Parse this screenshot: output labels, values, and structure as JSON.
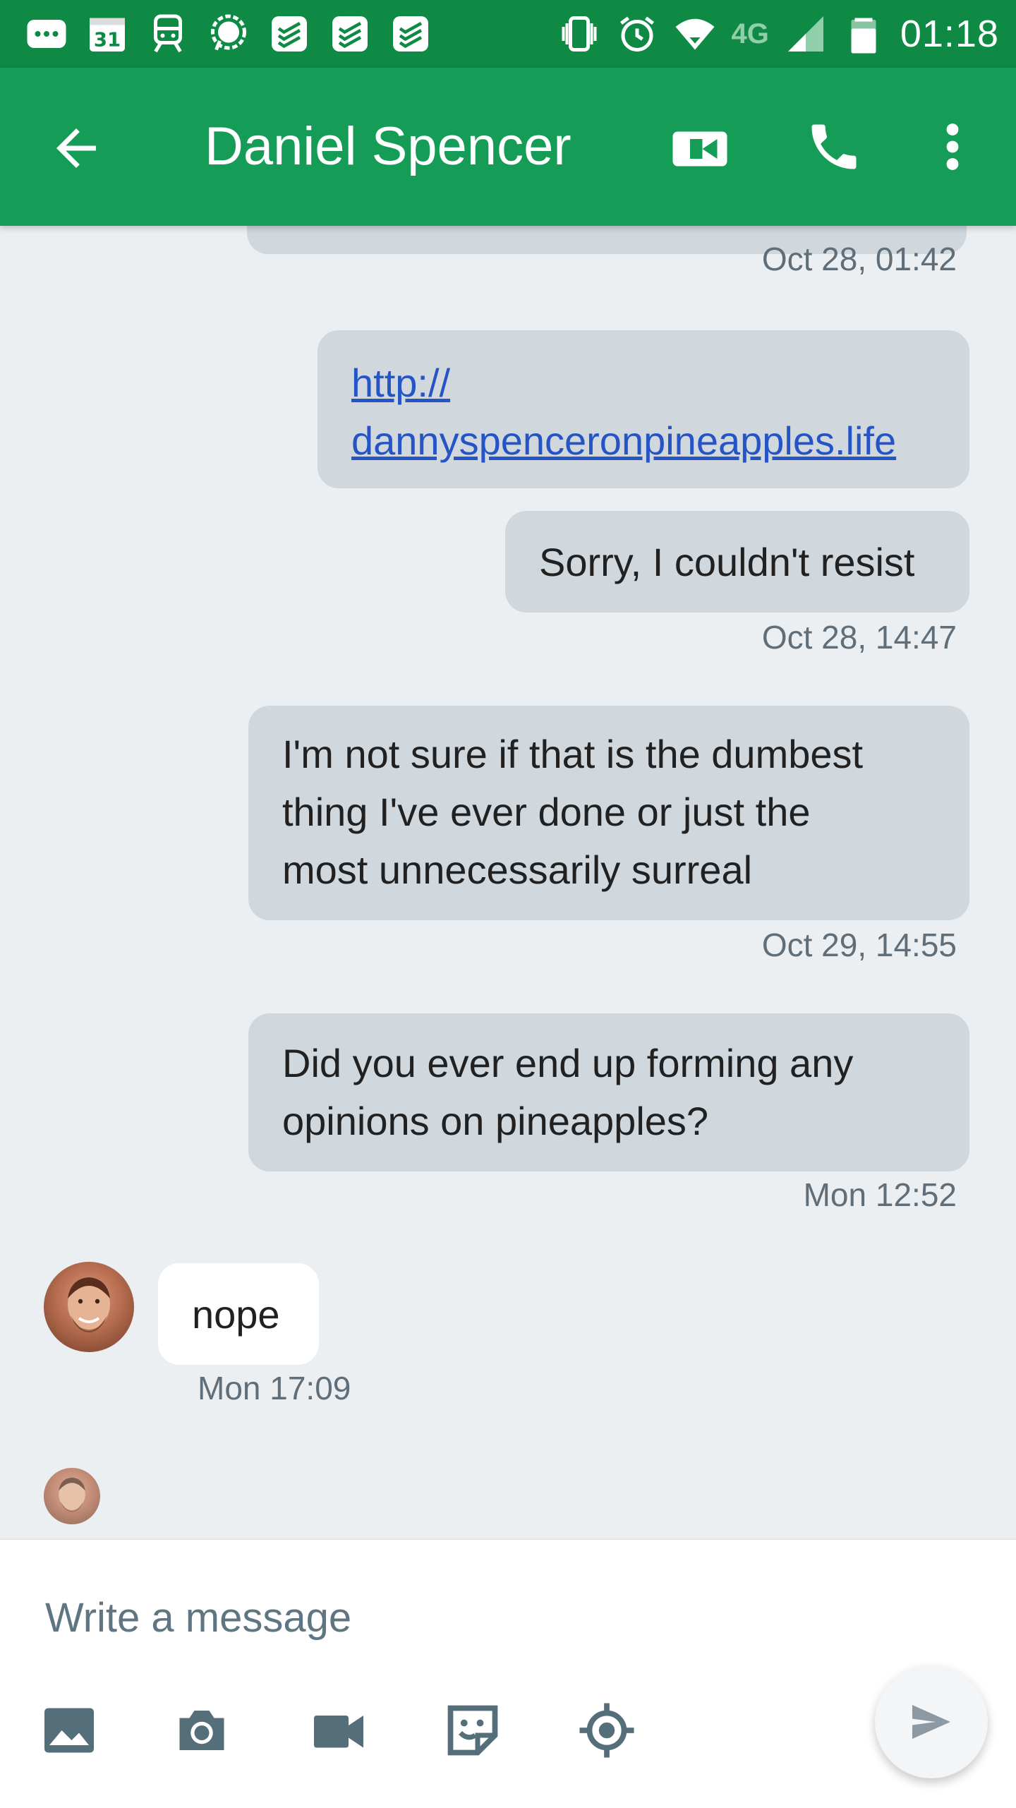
{
  "status_bar": {
    "time": "01:18",
    "calendar_day": "31",
    "network": "4G"
  },
  "header": {
    "title": "Daniel Spencer"
  },
  "messages": [
    {
      "text": "Oct 28, 01:42"
    },
    {
      "text": "http://",
      "text2": "dannyspenceronpineapples.life"
    },
    {
      "text": "Sorry, I couldn't resist",
      "time": "Oct 28, 14:47"
    },
    {
      "line1": "I'm not sure if that is the dumbest",
      "line2": "thing I've ever done or just the",
      "line3": "most unnecessarily surreal",
      "time": "Oct 29, 14:55"
    },
    {
      "line1": "Did you ever end up forming any",
      "line2": "opinions on pineapples?",
      "time": "Mon 12:52"
    },
    {
      "text": "nope",
      "time": "Mon 17:09"
    }
  ],
  "composer": {
    "placeholder": "Write a message"
  },
  "colors": {
    "status_bar": "#0e8a44",
    "app_bar": "#159d57",
    "bubble_out": "#d0d8de",
    "bubble_in": "#ffffff",
    "link": "#2554c7"
  }
}
